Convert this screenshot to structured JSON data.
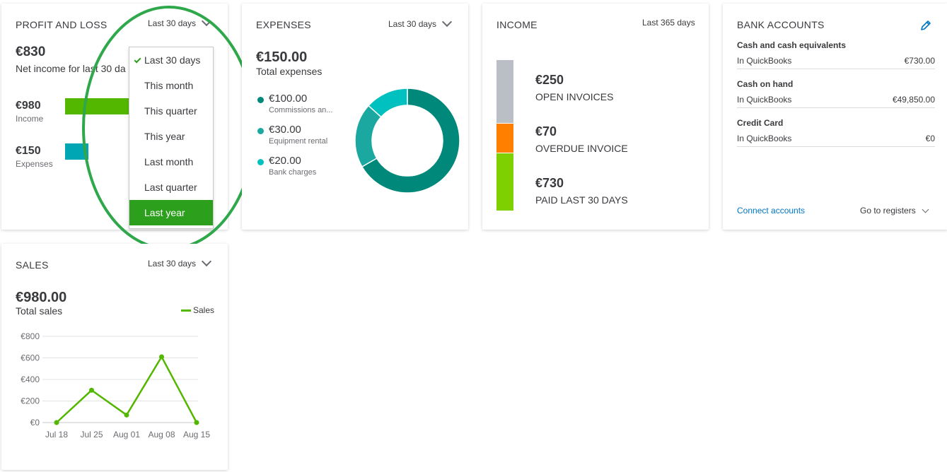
{
  "profit_loss": {
    "title": "PROFIT AND LOSS",
    "period": "Last 30 days",
    "net_amount": "€830",
    "net_label": "Net income for last 30 da",
    "income_amount": "€980",
    "income_label": "Income",
    "expenses_amount": "€150",
    "expenses_label": "Expenses",
    "income_fraction": 1.0,
    "expenses_fraction": 0.153,
    "dropdown": {
      "items": [
        "Last 30 days",
        "This month",
        "This quarter",
        "This year",
        "Last month",
        "Last quarter",
        "Last year"
      ],
      "checked": "Last 30 days",
      "highlighted": "Last year"
    }
  },
  "expenses": {
    "title": "EXPENSES",
    "period": "Last 30 days",
    "total_amount": "€150.00",
    "total_label": "Total expenses",
    "items": [
      {
        "amount": "€100.00",
        "label": "Commissions an...",
        "color": "#00897b",
        "value": 100
      },
      {
        "amount": "€30.00",
        "label": "Equipment rental",
        "color": "#1aa8a0",
        "value": 30
      },
      {
        "amount": "€20.00",
        "label": "Bank charges",
        "color": "#00c1bf",
        "value": 20
      }
    ]
  },
  "income": {
    "title": "INCOME",
    "period": "Last 365 days",
    "segments": [
      {
        "amount": "€250",
        "label": "OPEN INVOICES",
        "color": "#babec5",
        "value": 250
      },
      {
        "amount": "€70",
        "label": "OVERDUE INVOICE",
        "color": "#ff8000",
        "value": 70
      },
      {
        "amount": "€730",
        "label": "PAID LAST 30 DAYS",
        "color": "#7fd000",
        "value": 730
      }
    ]
  },
  "bank_accounts": {
    "title": "BANK ACCOUNTS",
    "edit_icon": "pencil-icon",
    "accounts": [
      {
        "name": "Cash and cash equivalents",
        "source": "In QuickBooks",
        "balance": "€730.00"
      },
      {
        "name": "Cash on hand",
        "source": "In QuickBooks",
        "balance": "€49,850.00"
      },
      {
        "name": "Credit Card",
        "source": "In QuickBooks",
        "balance": "€0"
      }
    ],
    "connect_label": "Connect accounts",
    "registers_label": "Go to registers"
  },
  "sales": {
    "title": "SALES",
    "period": "Last 30 days",
    "total_amount": "€980.00",
    "total_label": "Total sales",
    "legend": "Sales"
  },
  "chart_data": {
    "type": "line",
    "categories": [
      "Jul 18",
      "Jul 25",
      "Aug 01",
      "Aug 08",
      "Aug 15"
    ],
    "series": [
      {
        "name": "Sales",
        "values": [
          0,
          300,
          70,
          610,
          0
        ]
      }
    ],
    "y_ticks": [
      "€0",
      "€200",
      "€400",
      "€600",
      "€800"
    ],
    "ylim": [
      0,
      800
    ],
    "color": "#53b700",
    "grid": true,
    "legend_position": "top-right"
  },
  "annotation": {
    "color": "#2ea84a"
  }
}
